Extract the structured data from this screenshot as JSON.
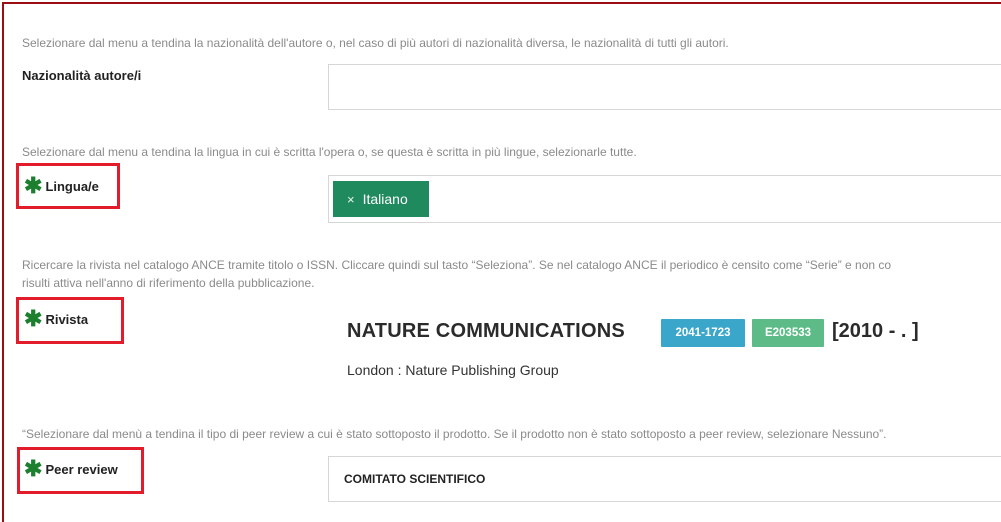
{
  "nazionalita": {
    "help": "Selezionare dal menu a tendina la nazionalità dell'autore o, nel caso di più autori di nazionalità diversa, le nazionalità di tutti gli autori.",
    "label": "Nazionalità autore/i",
    "value": ""
  },
  "lingua": {
    "help": "Selezionare dal menu a tendina la lingua in cui è scritta l'opera o, se questa è scritta in più lingue, selezionarle tutte.",
    "label": "Lingua/e",
    "required_mark": "✱",
    "chips": [
      {
        "remove": "×",
        "label": "Italiano"
      }
    ]
  },
  "rivista": {
    "help_line1": "Ricercare la rivista nel catalogo ANCE tramite titolo o ISSN. Cliccare quindi sul tasto “Seleziona”. Se nel catalogo ANCE il periodico è censito come “Serie” e non co",
    "help_line2": "risulti attiva nell'anno di riferimento della pubblicazione.",
    "label": "Rivista",
    "required_mark": "✱",
    "journal_title": "NATURE COMMUNICATIONS",
    "issn": "2041-1723",
    "ance_code": "E203533",
    "years": "[2010 - . ]",
    "publisher": "London : Nature Publishing Group"
  },
  "peer_review": {
    "help": "“Selezionare dal menù a tendina il tipo di peer review a cui è stato sottoposto il prodotto. Se il prodotto non è stato sottoposto a peer review, selezionare Nessuno”.",
    "label": "Peer review",
    "required_mark": "✱",
    "value": "COMITATO SCIENTIFICO"
  },
  "colors": {
    "frame": "#9b0d12",
    "highlight": "#e21c2a",
    "required_star": "#1b7f2d",
    "chip": "#1f8a5e",
    "issn_badge": "#3aa6c9",
    "ance_badge": "#5dbb87"
  }
}
